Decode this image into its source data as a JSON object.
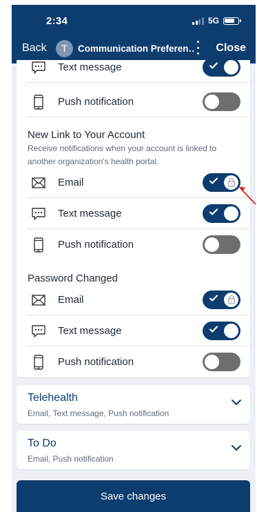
{
  "status_bar": {
    "time": "2:34",
    "network": "5G"
  },
  "nav": {
    "back_label": "Back",
    "avatar_initial": "T",
    "title": "Communication Preferen…",
    "close_label": "Close"
  },
  "top_rows": [
    {
      "label": "Text message",
      "icon": "message-icon",
      "on": true
    },
    {
      "label": "Push notification",
      "icon": "phone-icon",
      "on": false
    }
  ],
  "sections": [
    {
      "title": "New Link to Your Account",
      "description": "Receive notifications when your account is linked to another organization's health portal.",
      "rows": [
        {
          "label": "Email",
          "icon": "mail-icon",
          "on": true,
          "locked": true
        },
        {
          "label": "Text message",
          "icon": "message-icon",
          "on": true,
          "locked": false
        },
        {
          "label": "Push notification",
          "icon": "phone-icon",
          "on": false,
          "locked": false
        }
      ]
    },
    {
      "title": "Password Changed",
      "rows": [
        {
          "label": "Email",
          "icon": "mail-icon",
          "on": true,
          "locked": true
        },
        {
          "label": "Text message",
          "icon": "message-icon",
          "on": true,
          "locked": false
        },
        {
          "label": "Push notification",
          "icon": "phone-icon",
          "on": false,
          "locked": false
        }
      ]
    }
  ],
  "collapsed_cards": [
    {
      "title": "Telehealth",
      "subtitle": "Email, Text message, Push notification"
    },
    {
      "title": "To Do",
      "subtitle": "Email, Push notification"
    }
  ],
  "save_label": "Save changes",
  "colors": {
    "primary": "#0d3c6e",
    "toggle_off": "#6e6e6e",
    "background": "#edf0f4",
    "annotation_arrow": "#e02020"
  }
}
